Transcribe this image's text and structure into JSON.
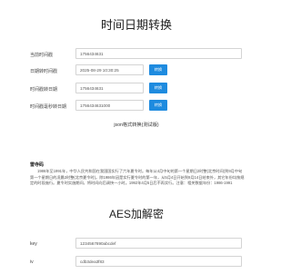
{
  "page": {
    "title": "时间日期转换",
    "aes_title": "AES加解密"
  },
  "converter": {
    "rows": [
      {
        "label": "当前时间戳",
        "value": "1756434631",
        "button": ""
      },
      {
        "label": "日期转时间戳",
        "value": "2025-08-29 10:30:25",
        "button": "转换"
      },
      {
        "label": "时间戳转日期",
        "value": "1756434631",
        "button": "转换"
      },
      {
        "label": "时间戳毫秒转日期",
        "value": "1756434631000",
        "button": "转换"
      }
    ]
  },
  "json_link": "json格式转换(测试版)",
  "article": {
    "heading": "雷寺码",
    "body": "1986年至1991年，中华人民共和国在我国国实行了六年夏令时。每年从4月中旬的第一个星期日2时整(北京时间)到9月中旬第一个星期日的凌晨2时整(北京夏令时)。除1986年因是实行夏令时的第一年，从5月4日开始到9月14日结束外，其它年份均按规定的时段施行。夏令时实施期间，将时间向后调快一小时。1992年4月5日后不再实行。注意：相关数据年份：1986-1991"
  },
  "aes": {
    "rows": [
      {
        "label": "key",
        "value": "1234567890abcdef"
      },
      {
        "label": "iv",
        "value": "cdb3dea3f83"
      }
    ]
  }
}
